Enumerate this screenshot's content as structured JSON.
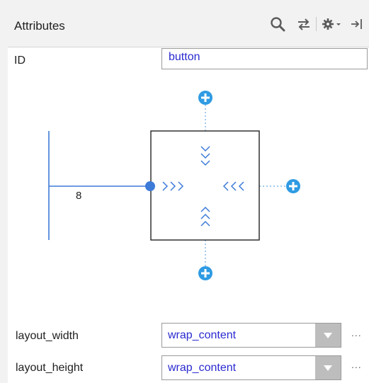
{
  "header": {
    "title": "Attributes",
    "icons": [
      "search-icon",
      "swap-icon",
      "gear-dropdown-icon",
      "hide-panel-icon"
    ]
  },
  "id_field": {
    "label": "ID",
    "value": "button"
  },
  "constraint_widget": {
    "left_margin": "8",
    "accent_color": "#3d7bd9",
    "add_button_color": "#2f9be3"
  },
  "layout_width": {
    "label": "layout_width",
    "value": "wrap_content",
    "more": "..."
  },
  "layout_height": {
    "label": "layout_height",
    "value": "wrap_content",
    "more": "..."
  }
}
